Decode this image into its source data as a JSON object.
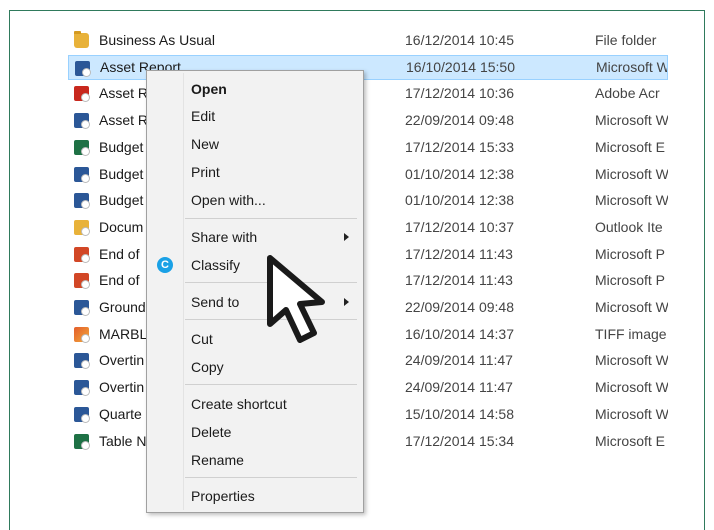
{
  "files": [
    {
      "name": "Business As Usual",
      "date": "16/12/2014 10:45",
      "type": "File folder",
      "icon": "folder-icon",
      "selected": false
    },
    {
      "name": "Asset Report",
      "date": "16/10/2014 15:50",
      "type": "Microsoft W",
      "icon": "word-doc-icon",
      "selected": true
    },
    {
      "name": "Asset R",
      "date": "17/12/2014 10:36",
      "type": "Adobe Acr",
      "icon": "pdf-icon",
      "selected": false
    },
    {
      "name": "Asset R",
      "date": "22/09/2014 09:48",
      "type": "Microsoft W",
      "icon": "word-doc-icon",
      "selected": false
    },
    {
      "name": "Budget",
      "date": "17/12/2014 15:33",
      "type": "Microsoft E",
      "icon": "excel-icon",
      "selected": false
    },
    {
      "name": "Budget",
      "date": "01/10/2014 12:38",
      "type": "Microsoft W",
      "icon": "word-doc-icon",
      "selected": false
    },
    {
      "name": "Budget",
      "date": "01/10/2014 12:38",
      "type": "Microsoft W",
      "icon": "word-doc-icon",
      "selected": false
    },
    {
      "name": "Docum",
      "date": "17/12/2014 10:37",
      "type": "Outlook Ite",
      "icon": "outlook-item-icon",
      "selected": false
    },
    {
      "name": "End of",
      "date": "17/12/2014 11:43",
      "type": "Microsoft P",
      "icon": "powerpoint-icon",
      "selected": false
    },
    {
      "name": "End of",
      "date": "17/12/2014 11:43",
      "type": "Microsoft P",
      "icon": "powerpoint-icon",
      "selected": false
    },
    {
      "name": "Ground",
      "date": "22/09/2014 09:48",
      "type": "Microsoft W",
      "icon": "word-doc-icon",
      "selected": false
    },
    {
      "name": "MARBL",
      "date": "16/10/2014 14:37",
      "type": "TIFF image",
      "icon": "tiff-image-icon",
      "selected": false
    },
    {
      "name": "Overtin",
      "date": "24/09/2014 11:47",
      "type": "Microsoft W",
      "icon": "word-doc-icon",
      "selected": false
    },
    {
      "name": "Overtin",
      "date": "24/09/2014 11:47",
      "type": "Microsoft W",
      "icon": "word-doc-icon",
      "selected": false
    },
    {
      "name": "Quarte",
      "date": "15/10/2014 14:58",
      "type": "Microsoft W",
      "icon": "word-doc-icon",
      "selected": false
    },
    {
      "name": "Table N",
      "date": "17/12/2014 15:34",
      "type": "Microsoft E",
      "icon": "excel-icon",
      "selected": false
    }
  ],
  "context_menu": {
    "open": "Open",
    "edit": "Edit",
    "new": "New",
    "print": "Print",
    "open_with": "Open with...",
    "share_with": "Share with",
    "classify": "Classify",
    "classify_icon_glyph": "C",
    "send_to": "Send to",
    "cut": "Cut",
    "copy": "Copy",
    "create_shortcut": "Create shortcut",
    "delete": "Delete",
    "rename": "Rename",
    "properties": "Properties"
  },
  "colors": {
    "frame_border": "#2f7a5c",
    "selection_bg": "#cce8ff",
    "selection_border": "#99d1ff",
    "classify_accent": "#1aa1e6",
    "menu_bg": "#f2f2f2"
  }
}
